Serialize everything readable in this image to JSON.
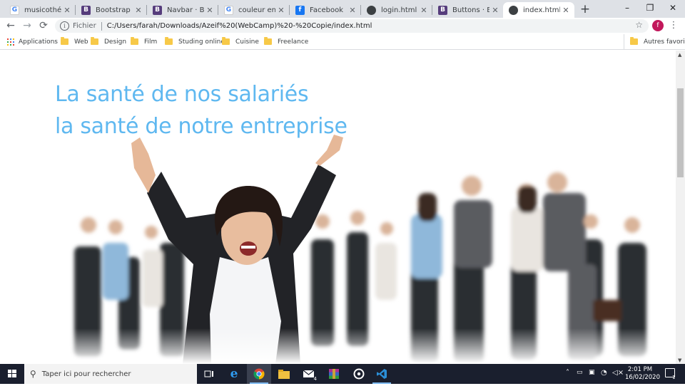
{
  "browser": {
    "tabs": [
      {
        "title": "musicothérapie",
        "icon": "google-icon",
        "favicon_letter": "G"
      },
      {
        "title": "Bootstrap · The",
        "icon": "bootstrap-icon",
        "favicon_letter": "B"
      },
      {
        "title": "Navbar · Boots",
        "icon": "bootstrap-icon",
        "favicon_letter": "B"
      },
      {
        "title": "couleur en htm",
        "icon": "google-icon",
        "favicon_letter": "G"
      },
      {
        "title": "Facebook",
        "icon": "facebook-icon",
        "favicon_letter": "f"
      },
      {
        "title": "login.html",
        "icon": "globe-icon",
        "favicon_letter": ""
      },
      {
        "title": "Buttons · Boot",
        "icon": "bootstrap-icon",
        "favicon_letter": "B"
      },
      {
        "title": "index.html",
        "icon": "globe-icon",
        "favicon_letter": "",
        "active": true
      }
    ],
    "new_tab_symbol": "+",
    "window_controls": {
      "minimize": "–",
      "maximize": "❐",
      "close": "✕"
    },
    "nav": {
      "back": "←",
      "forward": "→",
      "reload": "⟳"
    },
    "address": {
      "scheme_label": "Fichier",
      "url": "C:/Users/farah/Downloads/Azeif%20(WebCamp)%20-%20Copie/index.html",
      "info_symbol": "i",
      "star_symbol": "☆"
    },
    "profile_initial": "f",
    "menu_symbol": "⋮"
  },
  "bookmarks": {
    "apps_label": "Applications",
    "items": [
      "Web",
      "Design",
      "Film",
      "Studing online",
      "Cuisine",
      "Freelance"
    ],
    "other_label": "Autres favoris"
  },
  "page": {
    "headline_line1": "La santé de nos salariés",
    "headline_line2": "la santé de notre entreprise",
    "headline_color": "#5fb8f0"
  },
  "taskbar": {
    "search_placeholder": "Taper ici pour rechercher",
    "apps": [
      "task-view-icon",
      "edge-icon",
      "chrome-icon",
      "file-explorer-icon",
      "mail-icon",
      "winrar-icon",
      "media-player-icon",
      "vscode-icon"
    ],
    "mail_badge": "4",
    "time": "2:01 PM",
    "date": "16/02/2020",
    "notification_count": "1"
  }
}
